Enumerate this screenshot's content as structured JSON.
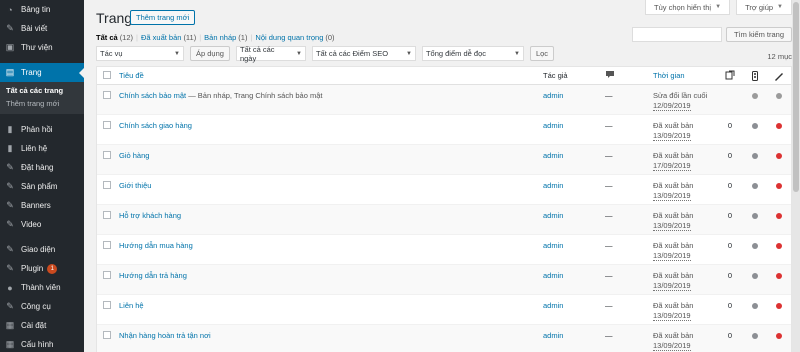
{
  "sidebar": {
    "items": [
      {
        "label": "Bảng tin",
        "icon": "dashboard-icon",
        "glyph": "◔"
      },
      {
        "label": "Bài viết",
        "icon": "pin-icon",
        "glyph": "✎"
      },
      {
        "label": "Thư viện",
        "icon": "media-icon",
        "glyph": "▣"
      },
      {
        "label": "Trang",
        "icon": "page-icon",
        "glyph": "▤",
        "active": true
      },
      {
        "label": "Phản hồi",
        "icon": "comment-icon",
        "glyph": "▮"
      },
      {
        "label": "Liên hệ",
        "icon": "contact-icon",
        "glyph": "▮"
      },
      {
        "label": "Đặt hàng",
        "icon": "order-icon",
        "glyph": "✎"
      },
      {
        "label": "Sản phẩm",
        "icon": "product-icon",
        "glyph": "✎"
      },
      {
        "label": "Banners",
        "icon": "banner-icon",
        "glyph": "✎"
      },
      {
        "label": "Video",
        "icon": "video-icon",
        "glyph": "✎"
      },
      {
        "label": "Giao diện",
        "icon": "appearance-icon",
        "glyph": "✎"
      },
      {
        "label": "Plugin",
        "icon": "plugin-icon",
        "glyph": "✎",
        "badge": "1"
      },
      {
        "label": "Thành viên",
        "icon": "users-icon",
        "glyph": "●"
      },
      {
        "label": "Công cụ",
        "icon": "tools-icon",
        "glyph": "✎"
      },
      {
        "label": "Cài đặt",
        "icon": "settings-icon",
        "glyph": "▦"
      },
      {
        "label": "Cấu hình",
        "icon": "config-icon",
        "glyph": "▦"
      }
    ],
    "submenu": [
      "Tất cả các trang",
      "Thêm trang mới"
    ]
  },
  "header": {
    "title": "Trang",
    "add_new": "Thêm trang mới",
    "screen_options": "Tùy chọn hiển thị",
    "help": "Trợ giúp"
  },
  "filters": {
    "all": "Tất cả",
    "all_count": "(12)",
    "published": "Đã xuất bản",
    "published_count": "(11)",
    "draft": "Bản nháp",
    "draft_count": "(1)",
    "cornerstone": "Nội dung quan trọng",
    "cornerstone_count": "(0)"
  },
  "search": {
    "placeholder": "",
    "button": "Tìm kiếm trang"
  },
  "tablenav": {
    "bulk_action": "Tác vụ",
    "apply": "Áp dụng",
    "dates": "Tất cả các ngày",
    "seo": "Tất cả các Điểm SEO",
    "readability": "Tổng điểm dễ đọc",
    "filter": "Lọc",
    "items": "12 mục"
  },
  "table": {
    "columns": {
      "title": "Tiêu đề",
      "author": "Tác giả",
      "date": "Thời gian"
    },
    "rows": [
      {
        "title": "Chính sách bảo mật",
        "state": " — Bản nháp, Trang Chính sách bảo mật",
        "author": "admin",
        "comments": "—",
        "status": "Sửa đổi lần cuối",
        "date": "12/09/2019",
        "links": "",
        "seo": "#9b9b9b",
        "read": "#9b9b9b"
      },
      {
        "title": "Chính sách giao hàng",
        "state": "",
        "author": "admin",
        "comments": "—",
        "status": "Đã xuất bản",
        "date": "13/09/2019",
        "links": "0",
        "seo": "#8c8f94",
        "read": "#dc3232"
      },
      {
        "title": "Giỏ hàng",
        "state": "",
        "author": "admin",
        "comments": "—",
        "status": "Đã xuất bản",
        "date": "17/09/2019",
        "links": "0",
        "seo": "#8c8f94",
        "read": "#dc3232"
      },
      {
        "title": "Giới thiệu",
        "state": "",
        "author": "admin",
        "comments": "—",
        "status": "Đã xuất bản",
        "date": "13/09/2019",
        "links": "0",
        "seo": "#8c8f94",
        "read": "#dc3232"
      },
      {
        "title": "Hỗ trợ khách hàng",
        "state": "",
        "author": "admin",
        "comments": "—",
        "status": "Đã xuất bản",
        "date": "13/09/2019",
        "links": "0",
        "seo": "#8c8f94",
        "read": "#dc3232"
      },
      {
        "title": "Hướng dẫn mua hàng",
        "state": "",
        "author": "admin",
        "comments": "—",
        "status": "Đã xuất bản",
        "date": "13/09/2019",
        "links": "0",
        "seo": "#8c8f94",
        "read": "#dc3232"
      },
      {
        "title": "Hướng dẫn trả hàng",
        "state": "",
        "author": "admin",
        "comments": "—",
        "status": "Đã xuất bản",
        "date": "13/09/2019",
        "links": "0",
        "seo": "#8c8f94",
        "read": "#dc3232"
      },
      {
        "title": "Liên hệ",
        "state": "",
        "author": "admin",
        "comments": "—",
        "status": "Đã xuất bản",
        "date": "13/09/2019",
        "links": "0",
        "seo": "#8c8f94",
        "read": "#dc3232"
      },
      {
        "title": "Nhận hàng hoàn trả tận nơi",
        "state": "",
        "author": "admin",
        "comments": "—",
        "status": "Đã xuất bản",
        "date": "13/09/2019",
        "links": "0",
        "seo": "#8c8f94",
        "read": "#dc3232"
      }
    ]
  },
  "colors": {
    "accent": "#0073aa",
    "sidebar_bg": "#23282d",
    "good": "#8c8f94",
    "bad": "#dc3232"
  }
}
